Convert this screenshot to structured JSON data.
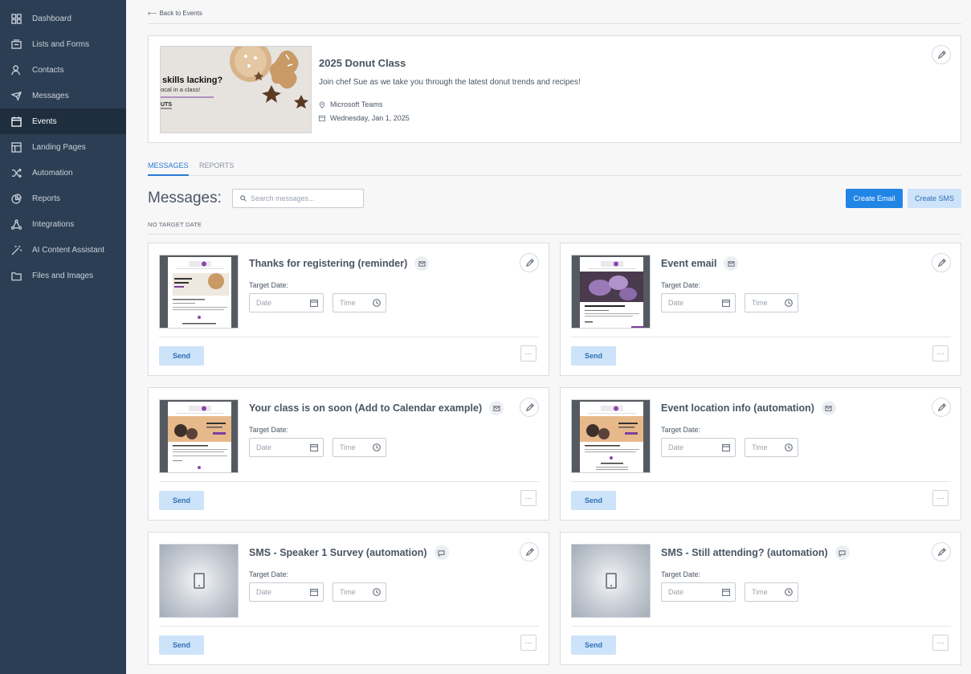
{
  "sidebar": {
    "items": [
      {
        "label": "Dashboard",
        "icon": "dashboard-icon"
      },
      {
        "label": "Lists and Forms",
        "icon": "lists-icon"
      },
      {
        "label": "Contacts",
        "icon": "contacts-icon"
      },
      {
        "label": "Messages",
        "icon": "messages-icon"
      },
      {
        "label": "Events",
        "icon": "calendar-icon",
        "active": true
      },
      {
        "label": "Landing Pages",
        "icon": "landing-pages-icon"
      },
      {
        "label": "Automation",
        "icon": "shuffle-icon"
      },
      {
        "label": "Reports",
        "icon": "pie-chart-icon"
      },
      {
        "label": "Integrations",
        "icon": "integrations-icon"
      },
      {
        "label": "AI Content Assistant",
        "icon": "magic-wand-icon"
      },
      {
        "label": "Files and Images",
        "icon": "folder-icon"
      }
    ]
  },
  "back_link": "Back to Events",
  "event": {
    "title": "2025 Donut Class",
    "description": "Join chef Sue as we take you through the latest donut trends and recipes!",
    "location": "Microsoft Teams",
    "date": "Wednesday, Jan 1, 2025",
    "image_text": {
      "line1": "skills lacking?",
      "line2": "ocal in a class!",
      "line3": "UTS"
    }
  },
  "tabs": [
    {
      "label": "MESSAGES",
      "active": true
    },
    {
      "label": "REPORTS",
      "active": false
    }
  ],
  "messages_heading": "Messages:",
  "search": {
    "placeholder": "Search messages..."
  },
  "actions": {
    "create_email": "Create Email",
    "create_sms": "Create SMS"
  },
  "section_label": "NO TARGET DATE",
  "cards": [
    {
      "title": "Thanks for registering (reminder)",
      "type": "email",
      "target_label": "Target Date:",
      "date_placeholder": "Date",
      "time_placeholder": "Time",
      "send_label": "Send",
      "more_label": "···"
    },
    {
      "title": "Event email",
      "type": "email",
      "target_label": "Target Date:",
      "date_placeholder": "Date",
      "time_placeholder": "Time",
      "send_label": "Send",
      "more_label": "···"
    },
    {
      "title": "Your class is on soon (Add to Calendar example)",
      "type": "email",
      "target_label": "Target Date:",
      "date_placeholder": "Date",
      "time_placeholder": "Time",
      "send_label": "Send",
      "more_label": "···"
    },
    {
      "title": "Event location info (automation)",
      "type": "email",
      "target_label": "Target Date:",
      "date_placeholder": "Date",
      "time_placeholder": "Time",
      "send_label": "Send",
      "more_label": "···"
    },
    {
      "title": "SMS - Speaker 1 Survey (automation)",
      "type": "sms",
      "target_label": "Target Date:",
      "date_placeholder": "Date",
      "time_placeholder": "Time",
      "send_label": "Send",
      "more_label": "···"
    },
    {
      "title": "SMS - Still attending? (automation)",
      "type": "sms",
      "target_label": "Target Date:",
      "date_placeholder": "Date",
      "time_placeholder": "Time",
      "send_label": "Send",
      "more_label": "···"
    }
  ],
  "colors": {
    "sidebar": "#2c3e53",
    "sidebar_active": "#1f2e3f",
    "accent": "#2185e6",
    "light_button": "#cde3f9"
  }
}
